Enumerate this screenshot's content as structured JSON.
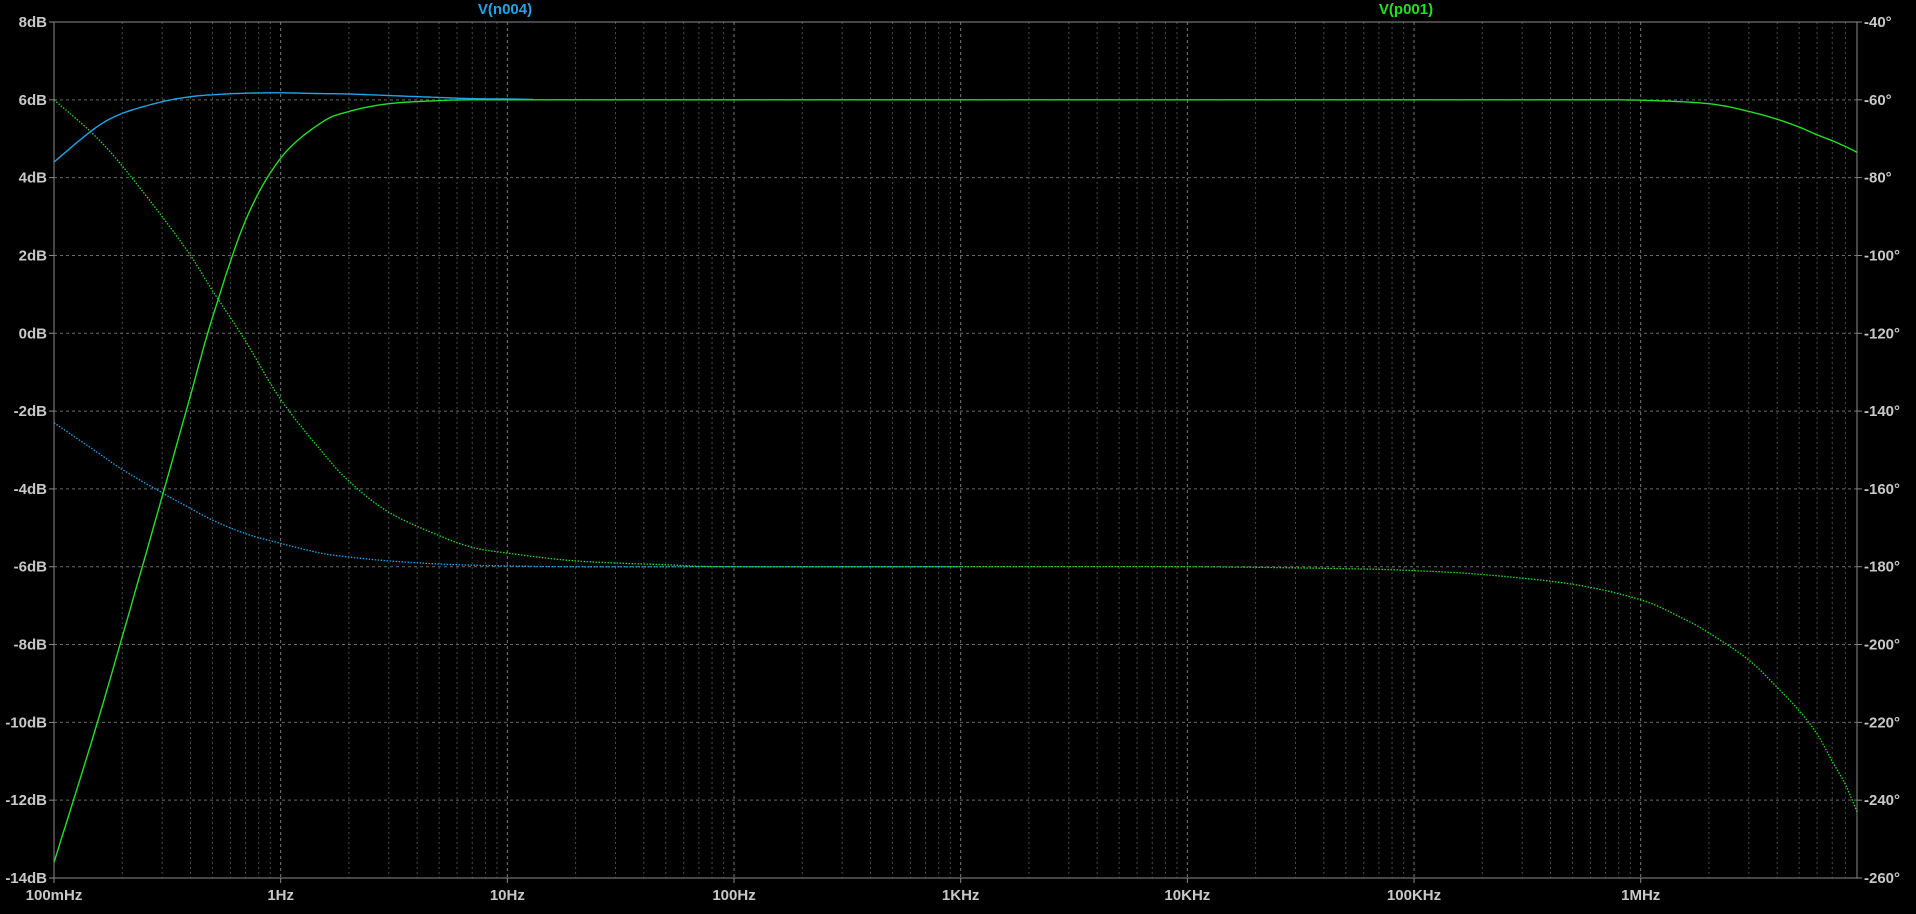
{
  "chart_data": {
    "type": "line",
    "style": "LTspice AC analysis, black background, dotted gray grid, log frequency axis, left magnitude axis, right phase axis",
    "x_scale": "log",
    "x_range": [
      0.1,
      9000000
    ],
    "x_ticks": [
      {
        "v": 0.1,
        "label": "100mHz"
      },
      {
        "v": 1,
        "label": "1Hz"
      },
      {
        "v": 10,
        "label": "10Hz"
      },
      {
        "v": 100,
        "label": "100Hz"
      },
      {
        "v": 1000,
        "label": "1KHz"
      },
      {
        "v": 10000,
        "label": "10KHz"
      },
      {
        "v": 100000,
        "label": "100KHz"
      },
      {
        "v": 1000000,
        "label": "1MHz"
      }
    ],
    "y_left_range": [
      -14,
      8
    ],
    "y_left_ticks": [
      {
        "v": 8,
        "label": "8dB"
      },
      {
        "v": 6,
        "label": "6dB"
      },
      {
        "v": 4,
        "label": "4dB"
      },
      {
        "v": 2,
        "label": "2dB"
      },
      {
        "v": 0,
        "label": "0dB"
      },
      {
        "v": -2,
        "label": "-2dB"
      },
      {
        "v": -4,
        "label": "-4dB"
      },
      {
        "v": -6,
        "label": "-6dB"
      },
      {
        "v": -8,
        "label": "-8dB"
      },
      {
        "v": -10,
        "label": "-10dB"
      },
      {
        "v": -12,
        "label": "-12dB"
      },
      {
        "v": -14,
        "label": "-14dB"
      }
    ],
    "y_right_range": [
      -260,
      -40
    ],
    "y_right_ticks": [
      {
        "v": -40,
        "label": "-40°"
      },
      {
        "v": -60,
        "label": "-60°"
      },
      {
        "v": -80,
        "label": "-80°"
      },
      {
        "v": -100,
        "label": "-100°"
      },
      {
        "v": -120,
        "label": "-120°"
      },
      {
        "v": -140,
        "label": "-140°"
      },
      {
        "v": -160,
        "label": "-160°"
      },
      {
        "v": -180,
        "label": "-180°"
      },
      {
        "v": -200,
        "label": "-200°"
      },
      {
        "v": -220,
        "label": "-220°"
      },
      {
        "v": -240,
        "label": "-240°"
      },
      {
        "v": -260,
        "label": "-260°"
      }
    ],
    "grid": true,
    "series": [
      {
        "name": "V(n004)",
        "color": "#1ea6e8",
        "magnitude_db": [
          [
            0.1,
            4.4
          ],
          [
            0.15,
            5.25
          ],
          [
            0.2,
            5.65
          ],
          [
            0.3,
            5.95
          ],
          [
            0.4,
            6.08
          ],
          [
            0.5,
            6.13
          ],
          [
            0.7,
            6.17
          ],
          [
            1,
            6.18
          ],
          [
            1.5,
            6.16
          ],
          [
            2,
            6.15
          ],
          [
            3,
            6.11
          ],
          [
            5,
            6.06
          ],
          [
            7,
            6.03
          ],
          [
            10,
            6.02
          ],
          [
            13,
            6.01
          ]
        ],
        "phase_deg": [
          [
            0.1,
            -143
          ],
          [
            0.15,
            -150
          ],
          [
            0.2,
            -155
          ],
          [
            0.3,
            -161
          ],
          [
            0.4,
            -165
          ],
          [
            0.5,
            -168
          ],
          [
            0.7,
            -171.5
          ],
          [
            1,
            -174
          ],
          [
            1.5,
            -176.5
          ],
          [
            2,
            -177.5
          ],
          [
            3,
            -178.5
          ],
          [
            5,
            -179.3
          ],
          [
            7,
            -179.6
          ],
          [
            10,
            -179.8
          ],
          [
            20,
            -180
          ],
          [
            100,
            -180
          ],
          [
            1000,
            -180
          ]
        ]
      },
      {
        "name": "V(p001)",
        "color": "#22e022",
        "magnitude_db": [
          [
            0.1,
            -13.6
          ],
          [
            0.15,
            -10.3
          ],
          [
            0.2,
            -7.8
          ],
          [
            0.3,
            -4.2
          ],
          [
            0.4,
            -1.6
          ],
          [
            0.5,
            0.4
          ],
          [
            0.7,
            2.9
          ],
          [
            1,
            4.5
          ],
          [
            1.5,
            5.4
          ],
          [
            2,
            5.7
          ],
          [
            3,
            5.9
          ],
          [
            5,
            5.98
          ],
          [
            7,
            6.0
          ],
          [
            10,
            6.0
          ],
          [
            100,
            6.0
          ],
          [
            1000,
            6.0
          ],
          [
            10000,
            6.0
          ],
          [
            100000,
            6.0
          ],
          [
            500000,
            6.0
          ],
          [
            1000000,
            5.99
          ],
          [
            2000000,
            5.9
          ],
          [
            3000000,
            5.7
          ],
          [
            4000000,
            5.5
          ],
          [
            5000000,
            5.3
          ],
          [
            6000000,
            5.1
          ],
          [
            7000000,
            4.95
          ],
          [
            8000000,
            4.8
          ],
          [
            9000000,
            4.65
          ]
        ],
        "phase_deg": [
          [
            0.1,
            -60
          ],
          [
            0.15,
            -69
          ],
          [
            0.2,
            -77
          ],
          [
            0.3,
            -90
          ],
          [
            0.4,
            -100
          ],
          [
            0.5,
            -109
          ],
          [
            0.7,
            -122
          ],
          [
            1,
            -137
          ],
          [
            1.5,
            -150
          ],
          [
            2,
            -158
          ],
          [
            3,
            -166
          ],
          [
            5,
            -172
          ],
          [
            7,
            -175
          ],
          [
            10,
            -176.5
          ],
          [
            20,
            -178.5
          ],
          [
            50,
            -179.5
          ],
          [
            100,
            -180
          ],
          [
            1000,
            -180
          ],
          [
            10000,
            -180
          ],
          [
            50000,
            -180.5
          ],
          [
            100000,
            -181
          ],
          [
            200000,
            -182
          ],
          [
            500000,
            -184.5
          ],
          [
            1000000,
            -188.5
          ],
          [
            1500000,
            -193
          ],
          [
            2000000,
            -197
          ],
          [
            3000000,
            -204
          ],
          [
            4000000,
            -211
          ],
          [
            5000000,
            -217
          ],
          [
            6000000,
            -223
          ],
          [
            7000000,
            -230
          ],
          [
            8000000,
            -236
          ],
          [
            9000000,
            -243
          ]
        ]
      }
    ]
  }
}
